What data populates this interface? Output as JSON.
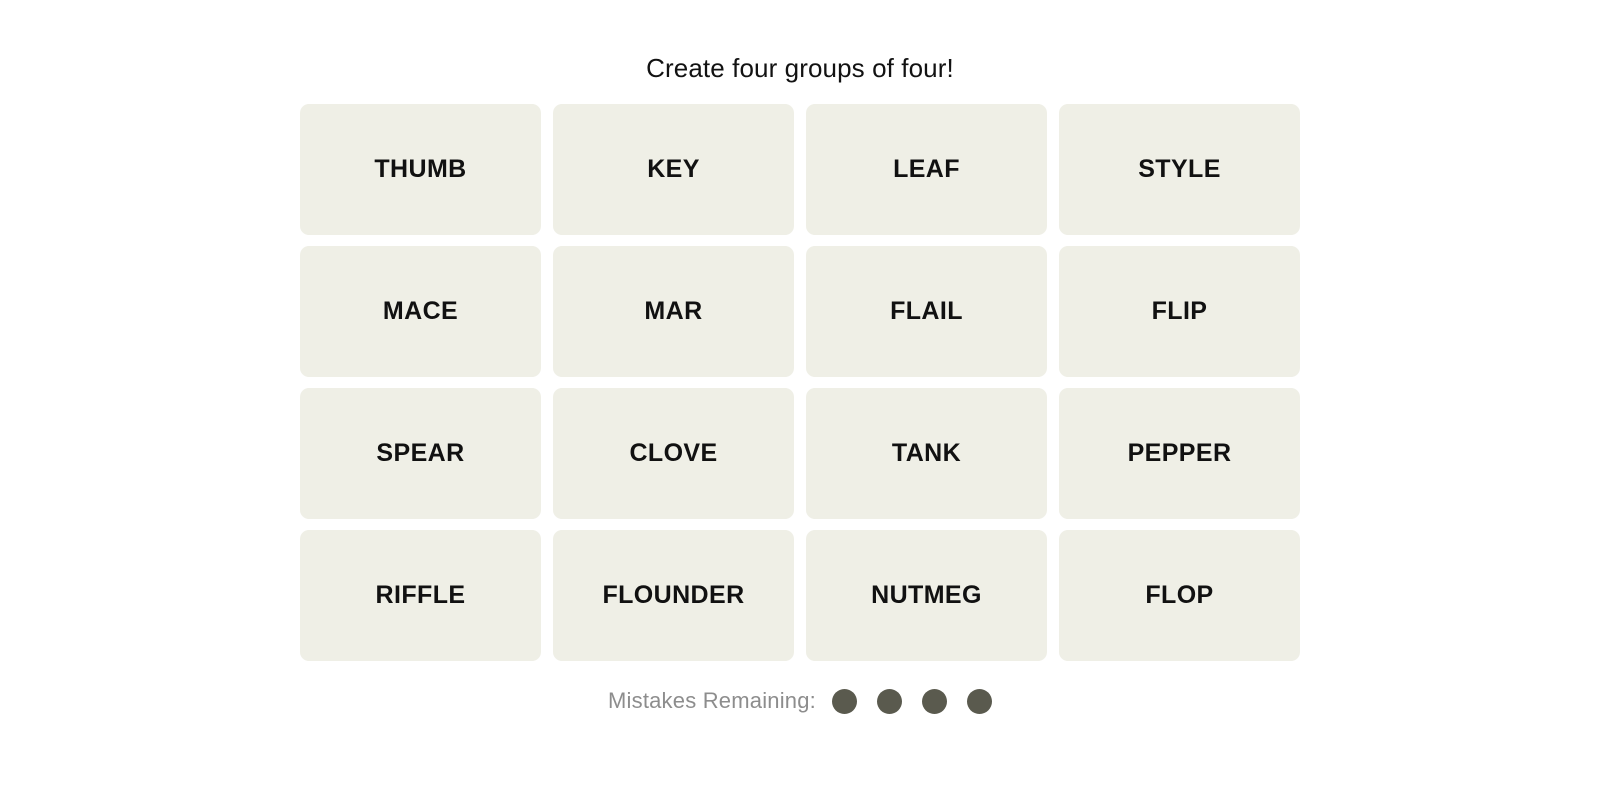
{
  "instruction": "Create four groups of four!",
  "grid": {
    "columns": 4,
    "rows": 4,
    "tiles": [
      {
        "label": "THUMB"
      },
      {
        "label": "KEY"
      },
      {
        "label": "LEAF"
      },
      {
        "label": "STYLE"
      },
      {
        "label": "MACE"
      },
      {
        "label": "MAR"
      },
      {
        "label": "FLAIL"
      },
      {
        "label": "FLIP"
      },
      {
        "label": "SPEAR"
      },
      {
        "label": "CLOVE"
      },
      {
        "label": "TANK"
      },
      {
        "label": "PEPPER"
      },
      {
        "label": "RIFFLE"
      },
      {
        "label": "FLOUNDER"
      },
      {
        "label": "NUTMEG"
      },
      {
        "label": "FLOP"
      }
    ]
  },
  "mistakes": {
    "label": "Mistakes Remaining:",
    "remaining": 4,
    "dots": [
      {
        "state": "filled"
      },
      {
        "state": "filled"
      },
      {
        "state": "filled"
      },
      {
        "state": "filled"
      }
    ]
  },
  "colors": {
    "page_background": "#ffffff",
    "tile_background": "#efefe6",
    "tile_text": "#111111",
    "instruction_text": "#121212",
    "mistakes_label_text": "#8d8d8d",
    "mistake_dot": "#5a5a4e"
  }
}
